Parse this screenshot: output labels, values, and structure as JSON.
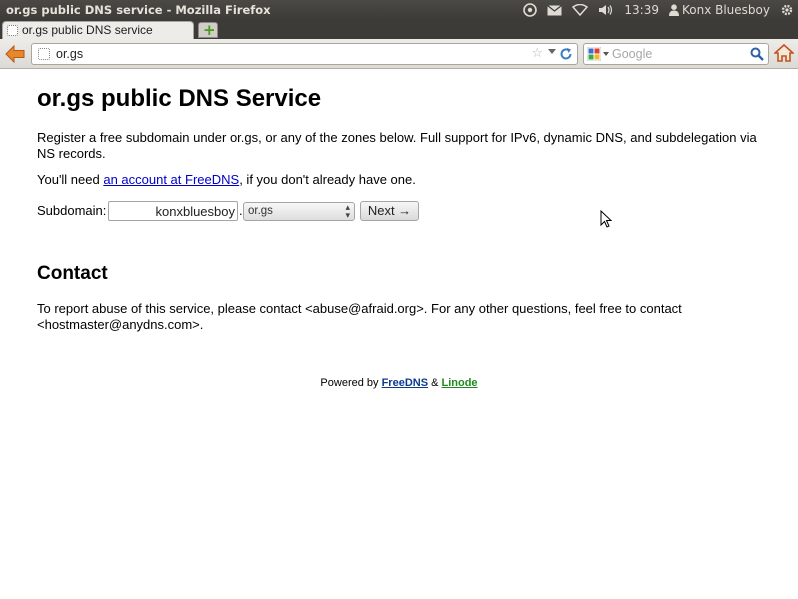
{
  "window": {
    "title": "or.gs public DNS service - Mozilla Firefox"
  },
  "tray": {
    "clock": "13:39",
    "user": "Konx Bluesboy"
  },
  "tabs": [
    {
      "label": "or.gs public DNS service"
    }
  ],
  "navbar": {
    "url": "or.gs",
    "search_placeholder": "Google"
  },
  "page": {
    "title": "or.gs public DNS Service",
    "intro": "Register a free subdomain under or.gs, or any of the zones below. Full support for IPv6, dynamic DNS, and subdelegation via NS records.",
    "need_prefix": "You'll need ",
    "need_link": "an account at FreeDNS",
    "need_suffix": ", if you don't already have one.",
    "form": {
      "subdomain_label": "Subdomain:",
      "subdomain_value": "konxbluesboy",
      "dot": ".",
      "zone_value": "or.gs",
      "next_label": "Next →"
    },
    "contact_title": "Contact",
    "contact_text": "To report abuse of this service, please contact <abuse@afraid.org>. For any other questions, feel free to contact <hostmaster@anydns.com>.",
    "footer": {
      "prefix": "Powered by ",
      "freedns": "FreeDNS",
      "amp": " & ",
      "linode": "Linode"
    }
  },
  "colors": {
    "link": "#0000cc",
    "freedns_link": "#0c3a8d",
    "linode_link": "#1f8a1f",
    "titlebar": "#3c3b37"
  }
}
